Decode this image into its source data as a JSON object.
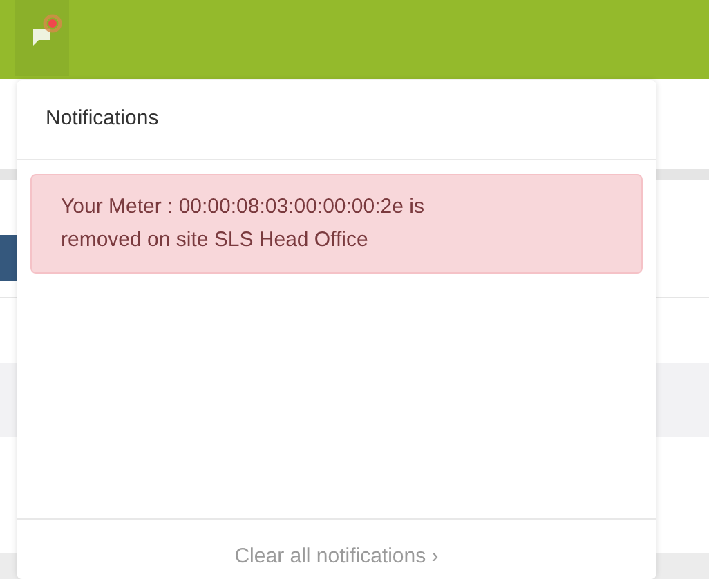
{
  "topbar": {
    "notification_unread": true
  },
  "notifications_panel": {
    "title": "Notifications",
    "items": [
      {
        "kind": "danger",
        "text": "Your Meter : 00:00:08:03:00:00:00:2e is removed on site SLS Head Office"
      }
    ],
    "footer_link": "Clear all notifications ›"
  }
}
